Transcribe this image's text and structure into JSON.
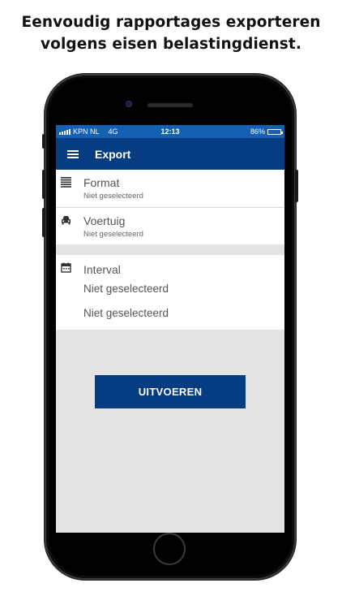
{
  "headline": {
    "line1": "Eenvoudig rapportages exporteren",
    "line2": "volgens eisen belastingdienst."
  },
  "status_bar": {
    "carrier": "KPN NL",
    "network": "4G",
    "time": "12:13",
    "battery": "86%",
    "battery_level": 0.86
  },
  "app_bar": {
    "menu_icon": "hamburger-menu-icon",
    "title": "Export"
  },
  "fields": [
    {
      "label": "Format",
      "value": "Niet geselecteerd",
      "icon": "list-lines-icon"
    },
    {
      "label": "Voertuig",
      "value": "Niet geselecteerd",
      "icon": "car-icon"
    }
  ],
  "interval": {
    "label": "Interval",
    "icon": "calendar-icon",
    "start": "Niet geselecteerd",
    "end": "Niet geselecteerd"
  },
  "actions": {
    "run_label": "UITVOEREN"
  },
  "colors": {
    "status_bar": "#1560b0",
    "app_bar": "#063d82",
    "button": "#063d82",
    "background": "#e3e3e3"
  }
}
